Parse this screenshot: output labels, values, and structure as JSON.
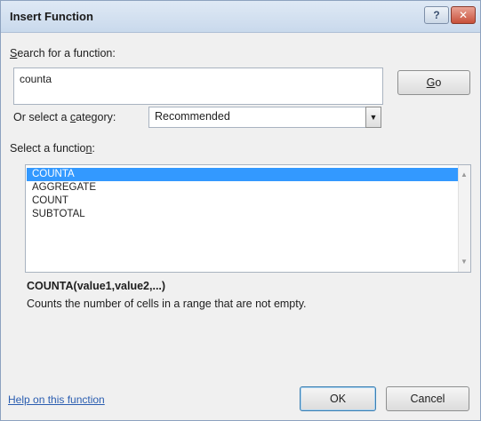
{
  "dialog": {
    "title": "Insert Function",
    "help_glyph": "?",
    "close_glyph": "✕"
  },
  "search": {
    "label_first": "S",
    "label_rest": "earch for a function:",
    "value": "counta",
    "go_first": "G",
    "go_rest": "o"
  },
  "category": {
    "label_start": "Or select a ",
    "label_mnemonic": "c",
    "label_end": "ategory:",
    "value": "Recommended",
    "arrow": "▼"
  },
  "functions": {
    "label_start": "Select a functio",
    "label_mnemonic": "n",
    "label_end": ":",
    "items": [
      "COUNTA",
      "AGGREGATE",
      "COUNT",
      "SUBTOTAL"
    ],
    "selected_index": 0,
    "scroll_up": "▲",
    "scroll_down": "▼"
  },
  "details": {
    "signature": "COUNTA(value1,value2,...)",
    "description": "Counts the number of cells in a range that are not empty."
  },
  "footer": {
    "help_link": "Help on this function",
    "ok": "OK",
    "cancel": "Cancel"
  }
}
